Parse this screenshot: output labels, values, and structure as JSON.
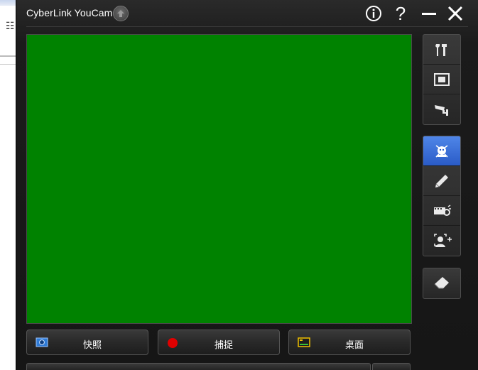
{
  "window": {
    "title": "CyberLink YouCam",
    "help_label": "?"
  },
  "preview": {
    "color": "#008200"
  },
  "side_toolbar": {
    "group1": [
      {
        "name": "settings",
        "icon": "tools-icon"
      },
      {
        "name": "fullscreen",
        "icon": "fullscreen-icon"
      },
      {
        "name": "surveillance",
        "icon": "security-camera-icon"
      }
    ],
    "group2": [
      {
        "name": "effects",
        "icon": "avatar-effect-icon",
        "active": true
      },
      {
        "name": "draw",
        "icon": "pencil-icon"
      },
      {
        "name": "scenes",
        "icon": "scene-filmstrip-icon"
      },
      {
        "name": "face-tracking",
        "icon": "face-add-icon"
      }
    ],
    "group3": [
      {
        "name": "eraser",
        "icon": "eraser-icon"
      }
    ]
  },
  "actions": {
    "snapshot_label": "快照",
    "capture_label": "捕捉",
    "desktop_label": "桌面"
  },
  "colors": {
    "accent_blue": "#3a6fd8",
    "record_red": "#e00000",
    "window_bg": "#1b1b1b"
  }
}
